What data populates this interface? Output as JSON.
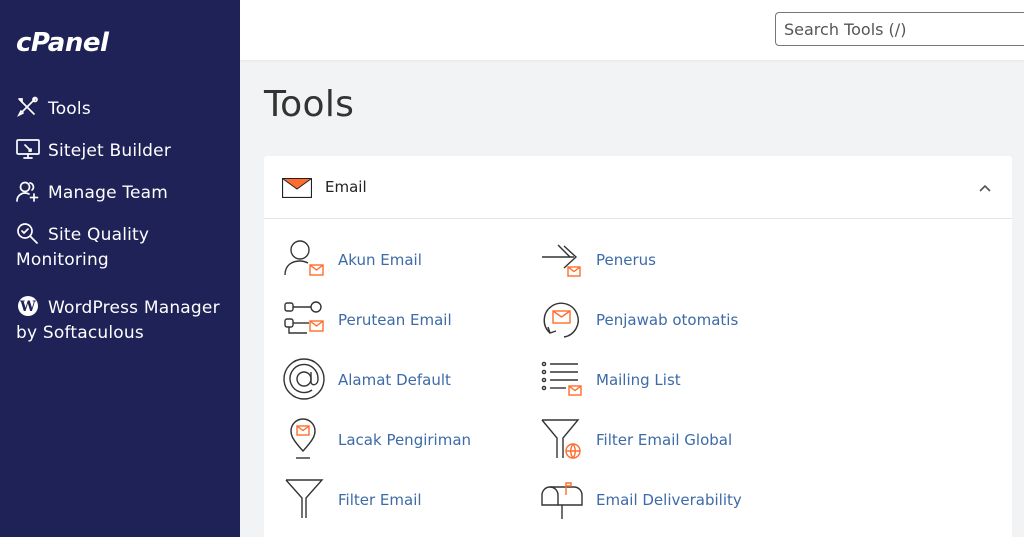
{
  "sidebar": {
    "logo": "cPanel",
    "items": [
      {
        "label": "Tools",
        "icon": "tools-icon"
      },
      {
        "label": "Sitejet Builder",
        "icon": "monitor-icon"
      },
      {
        "label": "Manage Team",
        "icon": "team-icon"
      },
      {
        "label": "Site Quality Monitoring",
        "icon": "magnifier-icon"
      },
      {
        "label": "WordPress Manager by Softaculous",
        "icon": "wordpress-icon"
      }
    ]
  },
  "search": {
    "placeholder": "Search Tools (/)",
    "value": ""
  },
  "page": {
    "title": "Tools"
  },
  "email_section": {
    "title": "Email",
    "tools": [
      {
        "label": "Akun Email",
        "icon": "email-accounts-icon"
      },
      {
        "label": "Penerus",
        "icon": "forwarders-icon"
      },
      {
        "label": "Perutean Email",
        "icon": "email-routing-icon"
      },
      {
        "label": "Penjawab otomatis",
        "icon": "autoresponders-icon"
      },
      {
        "label": "Alamat Default",
        "icon": "default-address-icon"
      },
      {
        "label": "Mailing List",
        "icon": "mailing-list-icon"
      },
      {
        "label": "Lacak Pengiriman",
        "icon": "track-delivery-icon"
      },
      {
        "label": "Filter Email Global",
        "icon": "global-filter-icon"
      },
      {
        "label": "Filter Email",
        "icon": "email-filter-icon"
      },
      {
        "label": "Email Deliverability",
        "icon": "mailbox-icon"
      }
    ]
  },
  "colors": {
    "sidebar": "#1f2257",
    "accent": "#ff6c2c",
    "link": "#3d6aa8"
  }
}
